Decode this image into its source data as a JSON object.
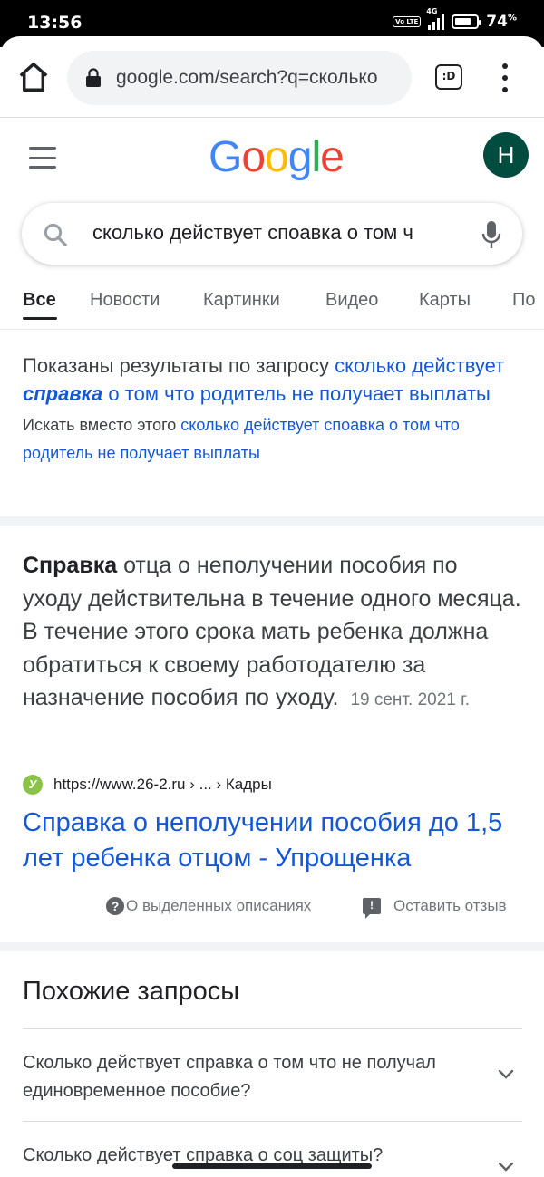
{
  "status_bar": {
    "time": "13:56",
    "volte": "Vo LTE",
    "network": "4G",
    "battery_pct": "74",
    "battery_unit": "%",
    "battery_level": 0.74
  },
  "browser": {
    "url": "google.com/search?q=сколько",
    "tabs_label": ":D"
  },
  "header": {
    "logo_letters": [
      "G",
      "o",
      "o",
      "g",
      "l",
      "e"
    ],
    "avatar_letter": "Н"
  },
  "search": {
    "query": "сколько действует споавка о том ч"
  },
  "tabs": [
    "Все",
    "Новости",
    "Картинки",
    "Видео",
    "Карты",
    "По"
  ],
  "spelling": {
    "prefix": "Показаны результаты по запросу",
    "corrected_1": "сколько действует",
    "corrected_bold": "справка",
    "corrected_2": "о том что родитель не получает выплаты",
    "alt_prefix": "Искать вместо этого",
    "alt_query": "сколько действует споавка о том что родитель не получает выплаты"
  },
  "snippet": {
    "bold": "Справка",
    "text": "отца о неполучении пособия по уходу действительна в течение одного месяца. В течение этого срока мать ребенка должна обратиться к своему работодателю за назначение пособия по уходу.",
    "date": "19 сент. 2021 г."
  },
  "result": {
    "favicon_letter": "У",
    "url": "https://www.26-2.ru › ... › Кадры",
    "title": "Справка о неполучении пособия до 1,5 лет ребенка отцом - Упрощенка"
  },
  "feedback": {
    "about": "О выделенных описаниях",
    "leave": "Оставить отзыв",
    "help_glyph": "?",
    "feedback_glyph": "!"
  },
  "related": {
    "title": "Похожие запросы",
    "items": [
      "Сколько действует справка о том что не получал единовременное пособие?",
      "Сколько действует справка о соц защиты?"
    ]
  },
  "colors": {
    "link": "#1558d6",
    "avatar": "#004d40",
    "favicon": "#8bc34a"
  }
}
